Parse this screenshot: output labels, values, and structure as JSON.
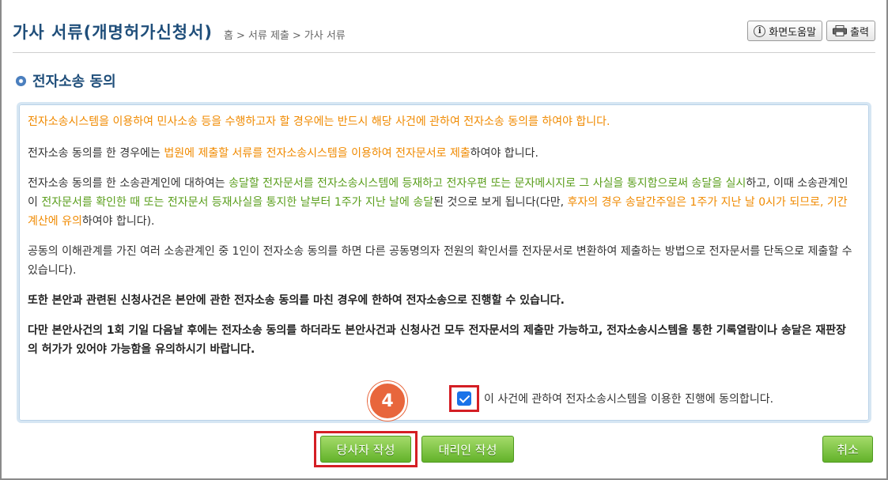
{
  "header": {
    "title": "가사 서류(개명허가신청서)",
    "breadcrumb": [
      "홈",
      "서류 제출",
      "가사 서류"
    ],
    "breadcrumb_sep": ">",
    "help_label": "화면도움말",
    "print_label": "출력"
  },
  "section": {
    "title": "전자소송 동의"
  },
  "notice": {
    "p1": "전자소송시스템을 이용하여 민사소송 등을 수행하고자 할 경우에는 반드시 해당 사건에 관하여 전자소송 동의를 하여야 합니다.",
    "p2_a": "전자소송 동의를 한 경우에는 ",
    "p2_b": "법원에 제출할 서류를 전자소송시스템을 이용하여 전자문서로 제출",
    "p2_c": "하여야 합니다.",
    "p3_a": "전자소송 동의를 한 소송관계인에 대하여는 ",
    "p3_b": "송달할 전자문서를 전자소송시스템에 등재하고 전자우편 또는 문자메시지로 그 사실을 통지함으로써 송달을 실시",
    "p3_c": "하고, 이때 소송관계인이 ",
    "p3_d": "전자문서를 확인한 때 또는 전자문서 등재사실을 통지한 날부터 1주가 지난 날에 송달",
    "p3_e": "된 것으로 보게 됩니다(다만, ",
    "p3_f": "후자의 경우 송달간주일은 1주가 지난 날 0시가 되므로, 기간 계산에 유의",
    "p3_g": "하여야 합니다).",
    "p4": "공동의 이해관계를 가진 여러 소송관계인 중 1인이 전자소송 동의를 하면 다른 공동명의자 전원의 확인서를 전자문서로 변환하여 제출하는 방법으로 전자문서를 단독으로 제출할 수 있습니다).",
    "p5": "또한 본안과 관련된 신청사건은 본안에 관한 전자소송 동의를 마친 경우에 한하여 전자소송으로 진행할 수 있습니다.",
    "p6": "다만 본안사건의 1회 기일 다음날 후에는 전자소송 동의를 하더라도 본안사건과 신청사건 모두 전자문서의 제출만 가능하고, 전자소송시스템을 통한 기록열람이나 송달은 재판장의 허가가 있어야 가능함을 유의하시기 바랍니다."
  },
  "agree": {
    "label": "이 사건에 관하여 전자소송시스템을 이용한 진행에 동의합니다.",
    "checked": true
  },
  "step_badge": "4",
  "buttons": {
    "party": "당사자 작성",
    "agent": "대리인 작성",
    "cancel": "취소"
  },
  "colors": {
    "title": "#1f4e7a",
    "orange_text": "#f08a00",
    "green_text": "#5a9e1c",
    "highlight_box": "#d41e24",
    "badge": "#e8663c",
    "green_button": "#63b22a",
    "checkbox": "#1a73e8"
  }
}
